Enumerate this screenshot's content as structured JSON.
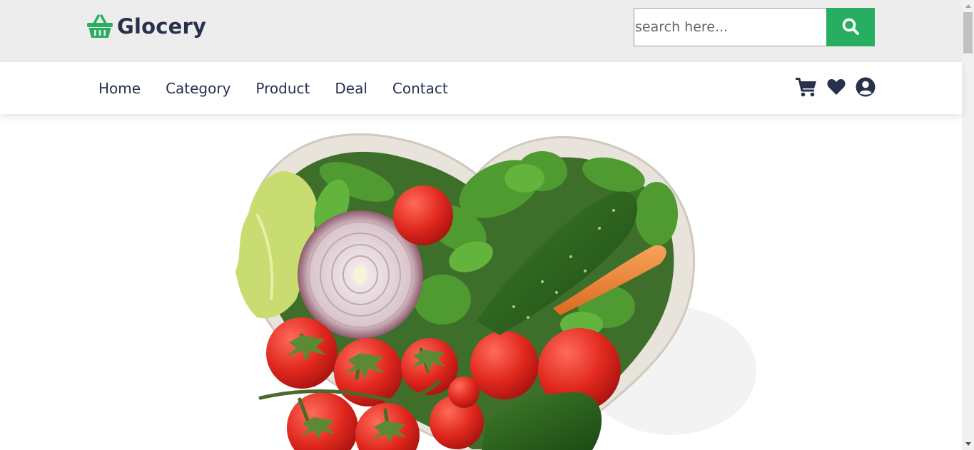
{
  "header": {
    "logo_text": "Glocery",
    "logo_icon": "shopping-basket-icon",
    "search": {
      "placeholder": "search here...",
      "button_icon": "search-icon"
    }
  },
  "nav": {
    "links": [
      "Home",
      "Category",
      "Product",
      "Deal",
      "Contact"
    ],
    "icons": [
      "shopping-cart-icon",
      "heart-icon",
      "user-circle-icon"
    ]
  },
  "hero": {
    "image": "heart-shaped-bowl-of-vegetables"
  },
  "colors": {
    "accent": "#27ae60",
    "text": "#27304d",
    "topbar_bg": "#ededed"
  }
}
